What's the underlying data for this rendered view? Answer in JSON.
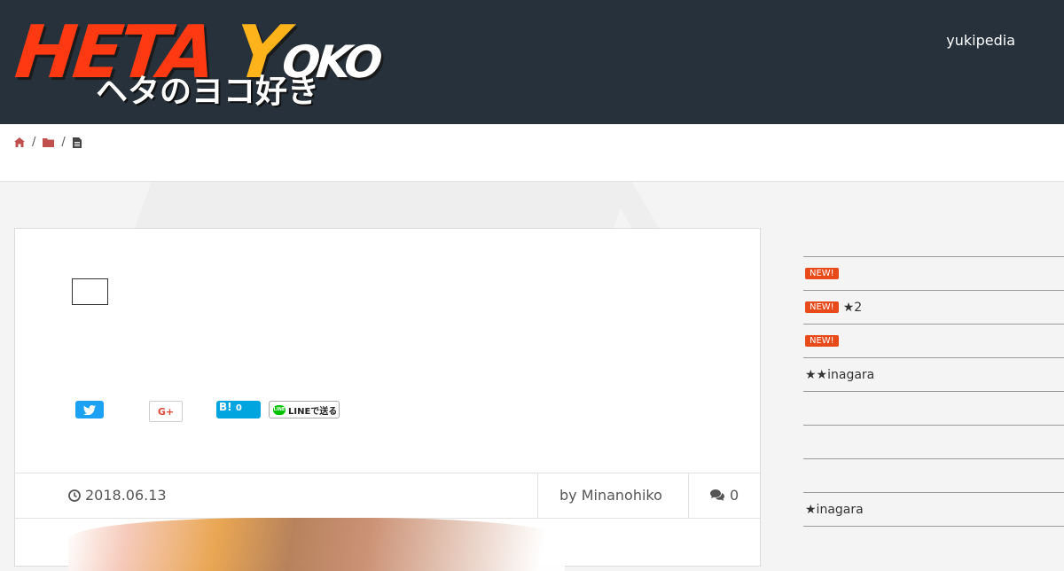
{
  "header": {
    "logo": {
      "main_h": "H",
      "main_eta": "ETA ",
      "main_y": "Y",
      "main_oko": "OKO",
      "sub": "ヘタのヨコ好き"
    },
    "nav_link": "yukipedia"
  },
  "breadcrumb": {
    "icons": [
      "home-icon",
      "folder-icon",
      "document-icon"
    ],
    "separator": "/"
  },
  "article": {
    "share": {
      "gplus": "G+",
      "hatena": "B!",
      "hatena_count": "0",
      "line": "LINEで送る",
      "line_logo": "LINE"
    },
    "meta": {
      "date": "2018.06.13",
      "author": "by Minanohiko",
      "comments": "0"
    }
  },
  "sidebar": {
    "items": [
      {
        "badge": "NEW!",
        "text": ""
      },
      {
        "badge": "NEW!",
        "text": "★2"
      },
      {
        "badge": "NEW!",
        "text": ""
      },
      {
        "badge": "",
        "text": "★★inagara"
      },
      {
        "badge": "",
        "text": ""
      },
      {
        "badge": "",
        "text": ""
      },
      {
        "badge": "",
        "text": ""
      },
      {
        "badge": "",
        "text": "★inagara"
      }
    ]
  },
  "colors": {
    "header_bg": "#27313b",
    "accent_red": "#ff3a12",
    "accent_yellow": "#ffb31a",
    "badge": "#e84a1a",
    "twitter": "#1da1f2",
    "hatena": "#00a4de",
    "line": "#00c300"
  }
}
